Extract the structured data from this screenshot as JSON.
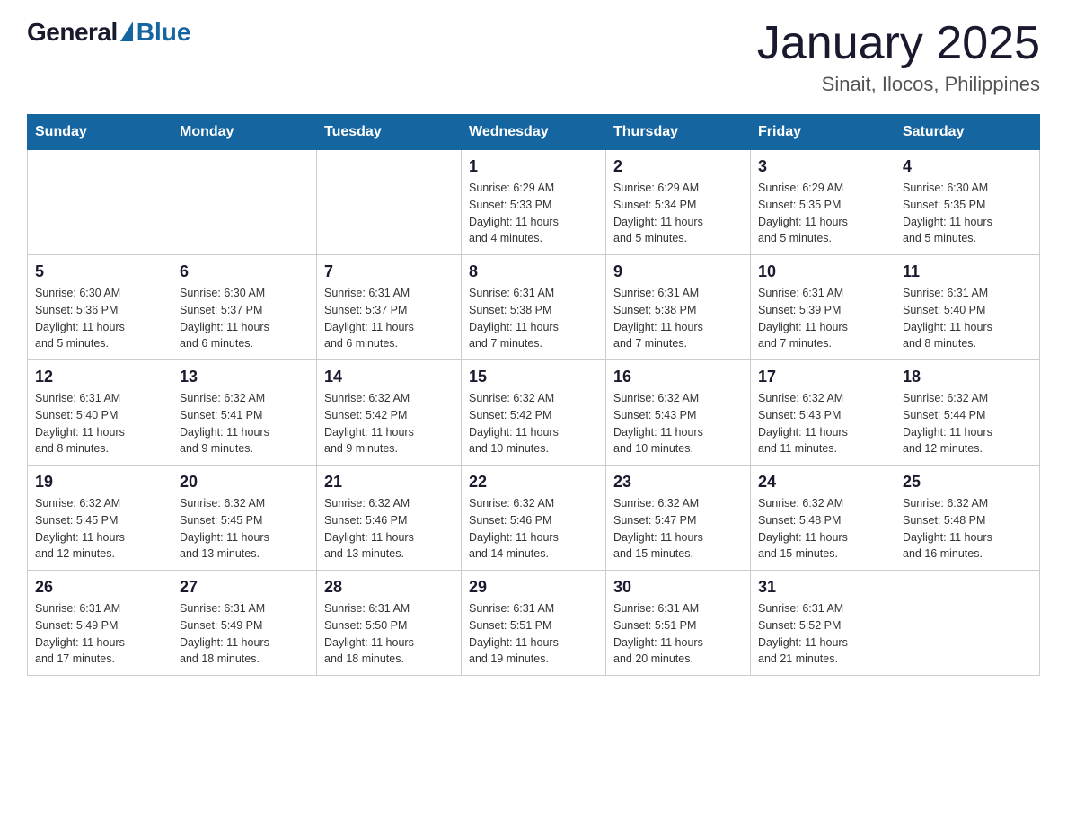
{
  "logo": {
    "general": "General",
    "blue": "Blue"
  },
  "title": "January 2025",
  "subtitle": "Sinait, Ilocos, Philippines",
  "headers": [
    "Sunday",
    "Monday",
    "Tuesday",
    "Wednesday",
    "Thursday",
    "Friday",
    "Saturday"
  ],
  "weeks": [
    [
      {
        "day": "",
        "info": ""
      },
      {
        "day": "",
        "info": ""
      },
      {
        "day": "",
        "info": ""
      },
      {
        "day": "1",
        "info": "Sunrise: 6:29 AM\nSunset: 5:33 PM\nDaylight: 11 hours\nand 4 minutes."
      },
      {
        "day": "2",
        "info": "Sunrise: 6:29 AM\nSunset: 5:34 PM\nDaylight: 11 hours\nand 5 minutes."
      },
      {
        "day": "3",
        "info": "Sunrise: 6:29 AM\nSunset: 5:35 PM\nDaylight: 11 hours\nand 5 minutes."
      },
      {
        "day": "4",
        "info": "Sunrise: 6:30 AM\nSunset: 5:35 PM\nDaylight: 11 hours\nand 5 minutes."
      }
    ],
    [
      {
        "day": "5",
        "info": "Sunrise: 6:30 AM\nSunset: 5:36 PM\nDaylight: 11 hours\nand 5 minutes."
      },
      {
        "day": "6",
        "info": "Sunrise: 6:30 AM\nSunset: 5:37 PM\nDaylight: 11 hours\nand 6 minutes."
      },
      {
        "day": "7",
        "info": "Sunrise: 6:31 AM\nSunset: 5:37 PM\nDaylight: 11 hours\nand 6 minutes."
      },
      {
        "day": "8",
        "info": "Sunrise: 6:31 AM\nSunset: 5:38 PM\nDaylight: 11 hours\nand 7 minutes."
      },
      {
        "day": "9",
        "info": "Sunrise: 6:31 AM\nSunset: 5:38 PM\nDaylight: 11 hours\nand 7 minutes."
      },
      {
        "day": "10",
        "info": "Sunrise: 6:31 AM\nSunset: 5:39 PM\nDaylight: 11 hours\nand 7 minutes."
      },
      {
        "day": "11",
        "info": "Sunrise: 6:31 AM\nSunset: 5:40 PM\nDaylight: 11 hours\nand 8 minutes."
      }
    ],
    [
      {
        "day": "12",
        "info": "Sunrise: 6:31 AM\nSunset: 5:40 PM\nDaylight: 11 hours\nand 8 minutes."
      },
      {
        "day": "13",
        "info": "Sunrise: 6:32 AM\nSunset: 5:41 PM\nDaylight: 11 hours\nand 9 minutes."
      },
      {
        "day": "14",
        "info": "Sunrise: 6:32 AM\nSunset: 5:42 PM\nDaylight: 11 hours\nand 9 minutes."
      },
      {
        "day": "15",
        "info": "Sunrise: 6:32 AM\nSunset: 5:42 PM\nDaylight: 11 hours\nand 10 minutes."
      },
      {
        "day": "16",
        "info": "Sunrise: 6:32 AM\nSunset: 5:43 PM\nDaylight: 11 hours\nand 10 minutes."
      },
      {
        "day": "17",
        "info": "Sunrise: 6:32 AM\nSunset: 5:43 PM\nDaylight: 11 hours\nand 11 minutes."
      },
      {
        "day": "18",
        "info": "Sunrise: 6:32 AM\nSunset: 5:44 PM\nDaylight: 11 hours\nand 12 minutes."
      }
    ],
    [
      {
        "day": "19",
        "info": "Sunrise: 6:32 AM\nSunset: 5:45 PM\nDaylight: 11 hours\nand 12 minutes."
      },
      {
        "day": "20",
        "info": "Sunrise: 6:32 AM\nSunset: 5:45 PM\nDaylight: 11 hours\nand 13 minutes."
      },
      {
        "day": "21",
        "info": "Sunrise: 6:32 AM\nSunset: 5:46 PM\nDaylight: 11 hours\nand 13 minutes."
      },
      {
        "day": "22",
        "info": "Sunrise: 6:32 AM\nSunset: 5:46 PM\nDaylight: 11 hours\nand 14 minutes."
      },
      {
        "day": "23",
        "info": "Sunrise: 6:32 AM\nSunset: 5:47 PM\nDaylight: 11 hours\nand 15 minutes."
      },
      {
        "day": "24",
        "info": "Sunrise: 6:32 AM\nSunset: 5:48 PM\nDaylight: 11 hours\nand 15 minutes."
      },
      {
        "day": "25",
        "info": "Sunrise: 6:32 AM\nSunset: 5:48 PM\nDaylight: 11 hours\nand 16 minutes."
      }
    ],
    [
      {
        "day": "26",
        "info": "Sunrise: 6:31 AM\nSunset: 5:49 PM\nDaylight: 11 hours\nand 17 minutes."
      },
      {
        "day": "27",
        "info": "Sunrise: 6:31 AM\nSunset: 5:49 PM\nDaylight: 11 hours\nand 18 minutes."
      },
      {
        "day": "28",
        "info": "Sunrise: 6:31 AM\nSunset: 5:50 PM\nDaylight: 11 hours\nand 18 minutes."
      },
      {
        "day": "29",
        "info": "Sunrise: 6:31 AM\nSunset: 5:51 PM\nDaylight: 11 hours\nand 19 minutes."
      },
      {
        "day": "30",
        "info": "Sunrise: 6:31 AM\nSunset: 5:51 PM\nDaylight: 11 hours\nand 20 minutes."
      },
      {
        "day": "31",
        "info": "Sunrise: 6:31 AM\nSunset: 5:52 PM\nDaylight: 11 hours\nand 21 minutes."
      },
      {
        "day": "",
        "info": ""
      }
    ]
  ]
}
